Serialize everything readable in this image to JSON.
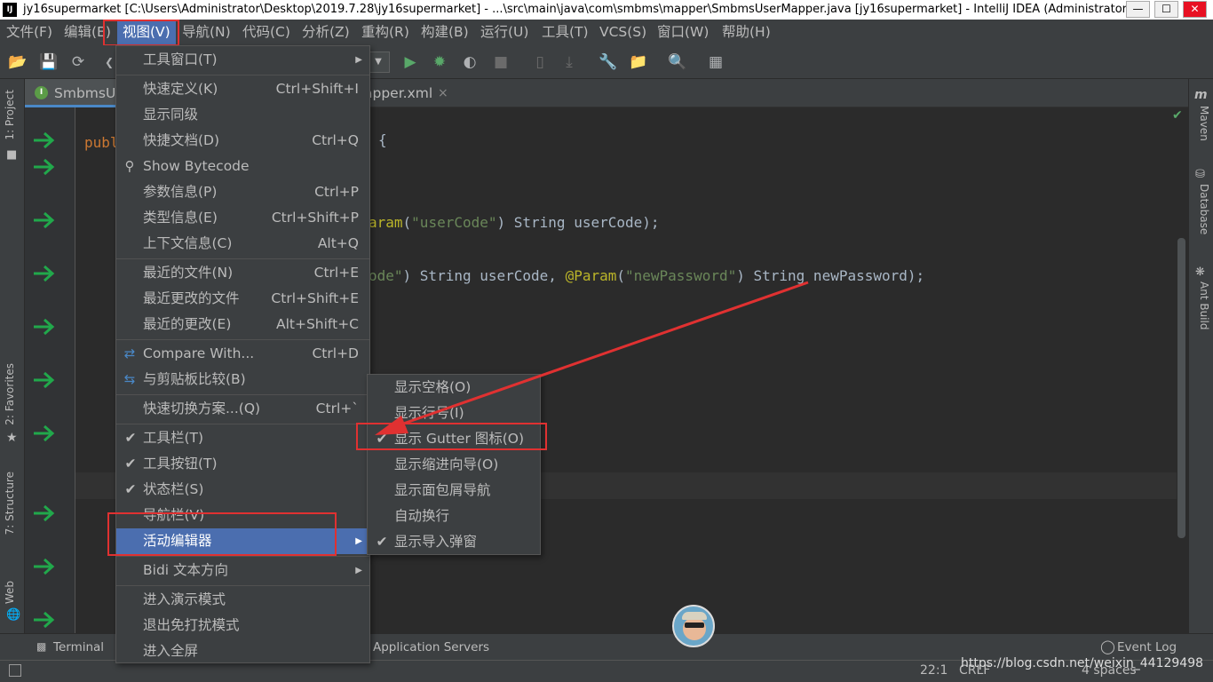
{
  "titlebar": {
    "title": "jy16supermarket [C:\\Users\\Administrator\\Desktop\\2019.7.28\\jy16supermarket] - ...\\src\\main\\java\\com\\smbms\\mapper\\SmbmsUserMapper.java [jy16supermarket] - IntelliJ IDEA (Administrator)",
    "app_icon": "IJ",
    "minimize": "—",
    "maximize": "☐",
    "close": "✕"
  },
  "menubar": {
    "items": [
      "文件(F)",
      "编辑(E)",
      "视图(V)",
      "导航(N)",
      "代码(C)",
      "分析(Z)",
      "重构(R)",
      "构建(B)",
      "运行(U)",
      "工具(T)",
      "VCS(S)",
      "窗口(W)",
      "帮助(H)"
    ]
  },
  "toolbar": {
    "icons": [
      "open-folder-icon",
      "save-icon",
      "sync-icon",
      "back-icon",
      "run-icon",
      "debug-icon",
      "coverage-icon",
      "profile-icon",
      "stop-icon",
      "build-artifact-icon",
      "deploy-icon",
      "wrench-icon",
      "project-structure-icon",
      "search-icon",
      "vcs-icon"
    ]
  },
  "left_strip": {
    "project": "1: Project",
    "favorites": "2: Favorites",
    "structure": "7: Structure",
    "web": "Web"
  },
  "right_strip": {
    "maven": "Maven",
    "database": "Database",
    "ant": "Ant Build"
  },
  "tabs": {
    "tab1": "SmbmsU",
    "tab2": "apper.xml",
    "tab2_close": "×"
  },
  "code": {
    "line1_kw": "publ",
    "line1_rest": "{",
    "line2_fn": "aram",
    "line2_str": "\"userCode\"",
    "line2_rest": ") String userCode);",
    "line3_a": "ode\") String userCode, ",
    "line3_ann": "@Param",
    "line3_b": "(",
    "line3_str": "\"newPassword\"",
    "line3_c": ") String newPassword);"
  },
  "view_menu": {
    "items": [
      {
        "label": "工具窗口(T)",
        "shortcut": "",
        "arrow": "▶"
      },
      {
        "label": "快速定义(K)",
        "shortcut": "Ctrl+Shift+I"
      },
      {
        "label": "显示同级",
        "shortcut": ""
      },
      {
        "label": "快捷文档(D)",
        "shortcut": "Ctrl+Q"
      },
      {
        "label": "Show Bytecode",
        "shortcut": ""
      },
      {
        "label": "参数信息(P)",
        "shortcut": "Ctrl+P"
      },
      {
        "label": "类型信息(E)",
        "shortcut": "Ctrl+Shift+P"
      },
      {
        "label": "上下文信息(C)",
        "shortcut": "Alt+Q"
      },
      {
        "label": "最近的文件(N)",
        "shortcut": "Ctrl+E"
      },
      {
        "label": "最近更改的文件",
        "shortcut": "Ctrl+Shift+E"
      },
      {
        "label": "最近的更改(E)",
        "shortcut": "Alt+Shift+C"
      },
      {
        "label": "Compare With...",
        "shortcut": "Ctrl+D"
      },
      {
        "label": "与剪贴板比较(B)",
        "shortcut": ""
      },
      {
        "label": "快速切换方案...(Q)",
        "shortcut": "Ctrl+`"
      },
      {
        "label": "工具栏(T)",
        "checked": "✔"
      },
      {
        "label": "工具按钮(T)",
        "checked": "✔"
      },
      {
        "label": "状态栏(S)",
        "checked": "✔"
      },
      {
        "label": "导航栏(V)",
        "shortcut": ""
      },
      {
        "label": "活动编辑器",
        "arrow": "▶"
      },
      {
        "label": "Bidi 文本方向",
        "arrow": "▶"
      },
      {
        "label": "进入演示模式",
        "shortcut": ""
      },
      {
        "label": "退出免打扰模式",
        "shortcut": ""
      },
      {
        "label": "进入全屏",
        "shortcut": ""
      }
    ]
  },
  "submenu": {
    "items": [
      {
        "label": "显示空格(O)"
      },
      {
        "label": "显示行号(I)"
      },
      {
        "label": "显示 Gutter 图标(O)",
        "checked": "✔"
      },
      {
        "label": "显示缩进向导(O)"
      },
      {
        "label": "显示面包屑导航"
      },
      {
        "label": "自动换行"
      },
      {
        "label": "显示导入弹窗",
        "checked": "✔"
      }
    ]
  },
  "bottom_bar": {
    "terminal": "Terminal",
    "app_servers": "Application Servers",
    "event_log": "Event Log"
  },
  "status_bar": {
    "position": "22:1",
    "line_sep": "CRLF",
    "indent": "4 spaces"
  },
  "watermark": "https://blog.csdn.net/weixin_44129498",
  "colors": {
    "accent": "#4b6eaf",
    "annotation_red": "#e03131",
    "gutter_arrow": "#21a84b"
  }
}
